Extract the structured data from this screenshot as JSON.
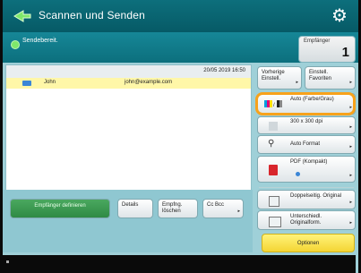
{
  "header": {
    "title": "Scannen und Senden"
  },
  "status": {
    "text": "Sendebereit."
  },
  "recipients": {
    "label": "Empfänger",
    "count": "1"
  },
  "list": {
    "timestamp": "20/05 2019 16:50",
    "rows": [
      {
        "name": "John",
        "email": "john@example.com"
      }
    ]
  },
  "bottom_buttons": {
    "define_recipient": "Empfänger definieren",
    "details": "Details",
    "receiver_search": "Empfng. löschen",
    "cc_bcc": "Cc Bcc"
  },
  "right_panel": {
    "prev_settings": "Vorherige Einstell.",
    "favorites": "Einstell. Favoriten",
    "color": "Auto (Farbe/Grau)",
    "resolution": "300 x 300 dpi",
    "format": "Auto Format",
    "pdf": "PDF (Kompakt)",
    "duplex": "Doppelseitig. Original",
    "mixed": "Unterschiedl. Originalform.",
    "options": "Optionen"
  },
  "colors": {
    "accent": "#0d6f7c",
    "highlight": "#f7a21b",
    "options_button": "#f4d534"
  }
}
